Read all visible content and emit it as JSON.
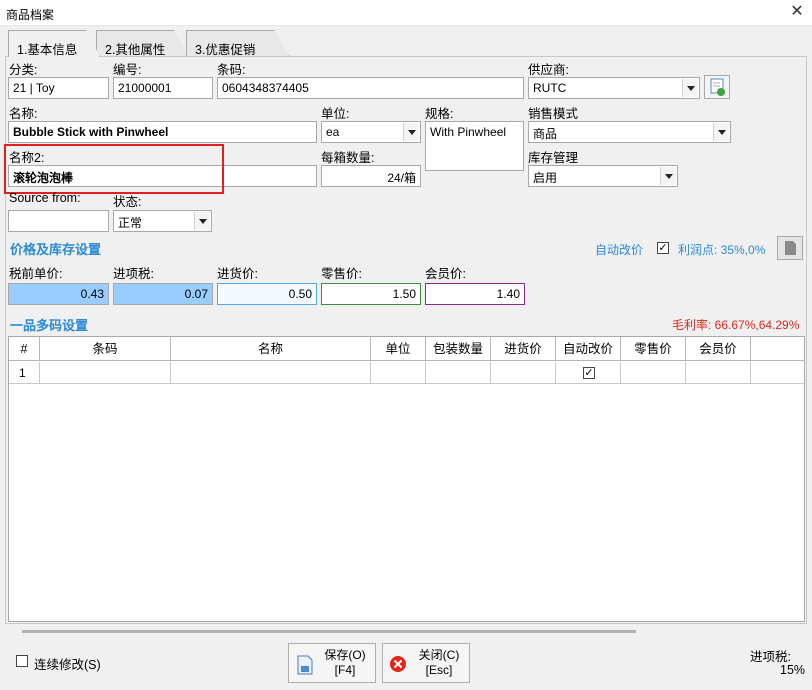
{
  "window": {
    "title": "商品档案",
    "close": "✕"
  },
  "tabs": [
    {
      "label": "1.基本信息"
    },
    {
      "label": "2.其他属性"
    },
    {
      "label": "3.优惠促销"
    }
  ],
  "fields": {
    "category": {
      "label": "分类:",
      "value": "21 | Toy"
    },
    "code": {
      "label": "编号:",
      "value": "21000001"
    },
    "barcode": {
      "label": "条码:",
      "value": "0604348374405"
    },
    "supplier": {
      "label": "供应商:",
      "value": "RUTC"
    },
    "name": {
      "label": "名称:",
      "value": "Bubble Stick with Pinwheel"
    },
    "unit": {
      "label": "单位:",
      "value": "ea"
    },
    "spec": {
      "label": "规格:",
      "value": "With Pinwheel"
    },
    "sales_mode": {
      "label": "销售模式",
      "value": "商品"
    },
    "name2": {
      "label": "名称2:",
      "value": "滚轮泡泡棒"
    },
    "per_box": {
      "label": "每箱数量:",
      "value": "24/箱"
    },
    "inventory": {
      "label": "库存管理",
      "value": "启用"
    },
    "source": {
      "label": "Source from:",
      "value": ""
    },
    "status": {
      "label": "状态:",
      "value": "正常"
    }
  },
  "price_section": {
    "title": "价格及库存设置",
    "auto_price_label": "自动改价",
    "auto_price_checked": true,
    "profit_point": "利润点: 35%,0%",
    "pretax_price": {
      "label": "税前单价:",
      "value": "0.43"
    },
    "input_tax": {
      "label": "进项税:",
      "value": "0.07"
    },
    "purchase_price": {
      "label": "进货价:",
      "value": "0.50"
    },
    "retail_price": {
      "label": "零售价:",
      "value": "1.50"
    },
    "member_price": {
      "label": "会员价:",
      "value": "1.40"
    }
  },
  "multi_code": {
    "title": "一品多码设置",
    "gross_margin": "毛利率: 66.67%,64.29%",
    "columns": [
      "#",
      "条码",
      "名称",
      "单位",
      "包装数量",
      "进货价",
      "自动改价",
      "零售价",
      "会员价"
    ],
    "rows": [
      {
        "index": "1",
        "barcode": "",
        "name": "",
        "unit": "",
        "pack_qty": "",
        "purchase": "",
        "auto_price": true,
        "retail": "",
        "member": ""
      }
    ]
  },
  "footer": {
    "continuous_edit": "连续修改(S)",
    "save_label": "保存(O)",
    "save_shortcut": "[F4]",
    "close_label": "关闭(C)",
    "close_shortcut": "[Esc]",
    "input_tax_label": "进项税:",
    "input_tax_value": "15%"
  },
  "colors": {
    "accent_blue": "#2a8ad8",
    "pretax_bg": "#99ccff",
    "purchase_border": "#55a7e6",
    "retail_border": "#3a8f3a",
    "member_border": "#8a2a8a",
    "highlight_red": "#e02020"
  }
}
